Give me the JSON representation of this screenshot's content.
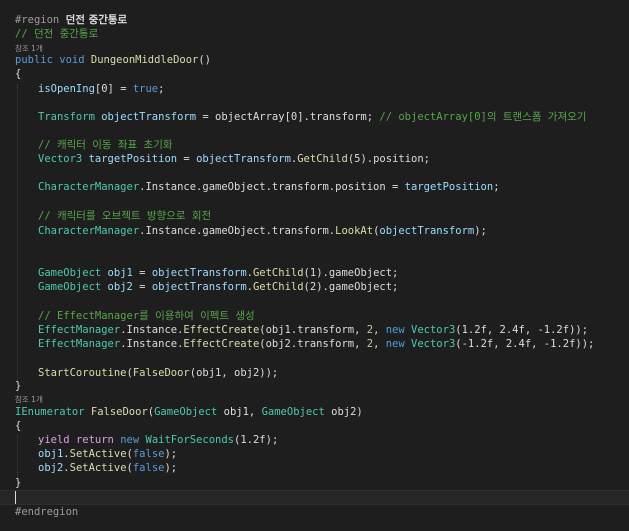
{
  "code": {
    "region_start": {
      "directive": "#region",
      "name": "던전 중간통로"
    },
    "comment_title": "// 던전 중간통로",
    "ref_count_1": "참조 1개",
    "method1": {
      "mod1": "public",
      "mod2": "void",
      "name": "DungeonMiddleDoor",
      "params": "()"
    },
    "open_brace": "{",
    "close_brace": "}",
    "l_isopening": {
      "name": "isOpenIng",
      "rest1": "[0] = ",
      "val": "true",
      "rest2": ";"
    },
    "l_transform": {
      "type": "Transform",
      "var": "objectTransform",
      "rest": " = objectArray[0].transform; ",
      "cmt": "// objectArray[0]의 트랜스폼 가져오기"
    },
    "cmt_move": "// 캐릭터 이동 좌표 초기화",
    "l_vector3": {
      "type": "Vector3",
      "var": "targetPosition",
      "eq": " = ",
      "obj": "objectTransform",
      "dot": ".",
      "fn": "GetChild",
      "args": "(5).position;"
    },
    "l_charpos": {
      "type": "CharacterManager",
      "rest": ".Instance.gameObject.transform.position = ",
      "var": "targetPosition",
      "end": ";"
    },
    "cmt_look": "// 캐릭터를 오브젝트 방향으로 회전",
    "l_lookat": {
      "type": "CharacterManager",
      "rest": ".Instance.gameObject.transform.",
      "fn": "LookAt",
      "open": "(",
      "var": "objectTransform",
      "end": ");"
    },
    "l_obj1": {
      "type": "GameObject",
      "var": "obj1",
      "eq": " = ",
      "obj": "objectTransform",
      "dot": ".",
      "fn": "GetChild",
      "args": "(1).gameObject;"
    },
    "l_obj2": {
      "type": "GameObject",
      "var": "obj2",
      "eq": " = ",
      "obj": "objectTransform",
      "dot": ".",
      "fn": "GetChild",
      "args": "(2).gameObject;"
    },
    "cmt_effect": "// EffectManager를 이용하여 이펙트 생성",
    "l_eff1": {
      "type": "EffectManager",
      "rest": ".Instance.",
      "fn": "EffectCreate",
      "a1": "(obj1.transform, ",
      "n1": "2",
      "c1": ", ",
      "kw": "new",
      "sp": " ",
      "t2": "Vector3",
      "a2": "(1.2f, 2.4f, -1.2f));"
    },
    "l_eff2": {
      "type": "EffectManager",
      "rest": ".Instance.",
      "fn": "EffectCreate",
      "a1": "(obj2.transform, ",
      "n1": "2",
      "c1": ", ",
      "kw": "new",
      "sp": " ",
      "t2": "Vector3",
      "a2": "(-1.2f, 2.4f, -1.2f));"
    },
    "l_coroutine": {
      "fn1": "StartCoroutine",
      "open": "(",
      "fn2": "FalseDoor",
      "args": "(obj1, obj2));"
    },
    "ref_count_2": "참조 1개",
    "method2": {
      "type": "IEnumerator",
      "name": "FalseDoor",
      "open": "(",
      "t1": "GameObject",
      "p1": " obj1, ",
      "t2": "GameObject",
      "p2": " obj2)"
    },
    "l_yield": {
      "kw1": "yield",
      "kw2": "return",
      "kw3": "new",
      "type": "WaitForSeconds",
      "args": "(1.2f);"
    },
    "l_active1": {
      "var": "obj1",
      "dot": ".",
      "fn": "SetActive",
      "open": "(",
      "val": "false",
      "end": ");"
    },
    "l_active2": {
      "var": "obj2",
      "dot": ".",
      "fn": "SetActive",
      "open": "(",
      "val": "false",
      "end": ");"
    },
    "region_end": "#endregion"
  },
  "colors": {
    "background": "#1e1e1e",
    "keyword": "#569cd6",
    "type": "#4ec9b0",
    "method": "#dcdcaa",
    "variable": "#9cdcfe",
    "comment": "#57a64a",
    "number": "#b5cea8",
    "control": "#d8a0df"
  }
}
